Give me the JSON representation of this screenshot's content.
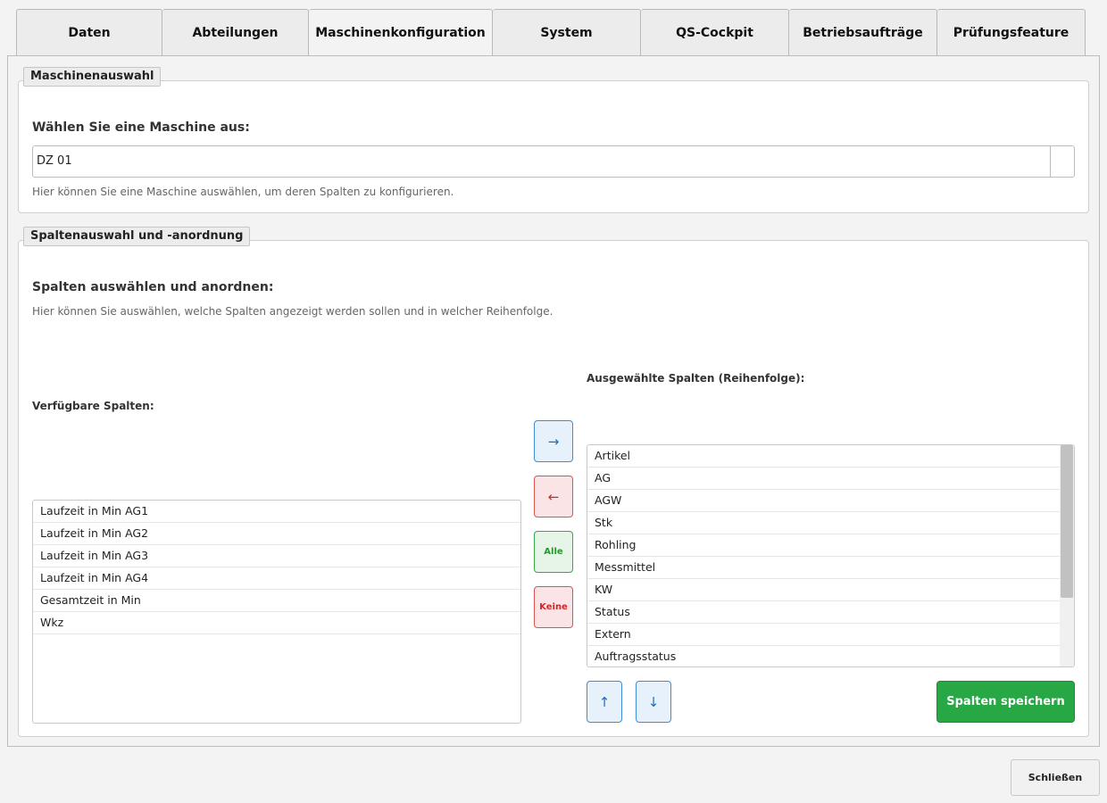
{
  "tabs": [
    {
      "label": "Daten"
    },
    {
      "label": "Abteilungen"
    },
    {
      "label": "Maschinenkonfiguration"
    },
    {
      "label": "System"
    },
    {
      "label": "QS-Cockpit"
    },
    {
      "label": "Betriebsaufträge"
    },
    {
      "label": "Prüfungsfeature"
    }
  ],
  "machine_section": {
    "legend": "Maschinenauswahl",
    "heading": "Wählen Sie eine Maschine aus:",
    "selected_machine": "DZ 01",
    "hint": "Hier können Sie eine Maschine auswählen, um deren Spalten zu konfigurieren."
  },
  "columns_section": {
    "legend": "Spaltenauswahl und -anordnung",
    "heading": "Spalten auswählen und anordnen:",
    "hint": "Hier können Sie auswählen, welche Spalten angezeigt werden sollen und in welcher Reihenfolge.",
    "available_label": "Verfügbare Spalten:",
    "selected_label": "Ausgewählte Spalten (Reihenfolge):",
    "available": [
      {
        "label": "Laufzeit in Min AG1"
      },
      {
        "label": "Laufzeit in Min AG2"
      },
      {
        "label": "Laufzeit in Min AG3"
      },
      {
        "label": "Laufzeit in Min AG4"
      },
      {
        "label": "Gesamtzeit in Min"
      },
      {
        "label": "Wkz"
      }
    ],
    "selected": [
      {
        "label": "Artikel"
      },
      {
        "label": "AG"
      },
      {
        "label": "AGW"
      },
      {
        "label": "Stk"
      },
      {
        "label": "Rohling"
      },
      {
        "label": "Messmittel"
      },
      {
        "label": "KW"
      },
      {
        "label": "Status"
      },
      {
        "label": "Extern"
      },
      {
        "label": "Auftragsstatus"
      }
    ],
    "add_icon": "→",
    "remove_icon": "←",
    "all_label": "Alle",
    "none_label": "Keine",
    "up_icon": "↑",
    "down_icon": "↓",
    "save_label": "Spalten speichern"
  },
  "footer": {
    "close_label": "Schließen"
  }
}
